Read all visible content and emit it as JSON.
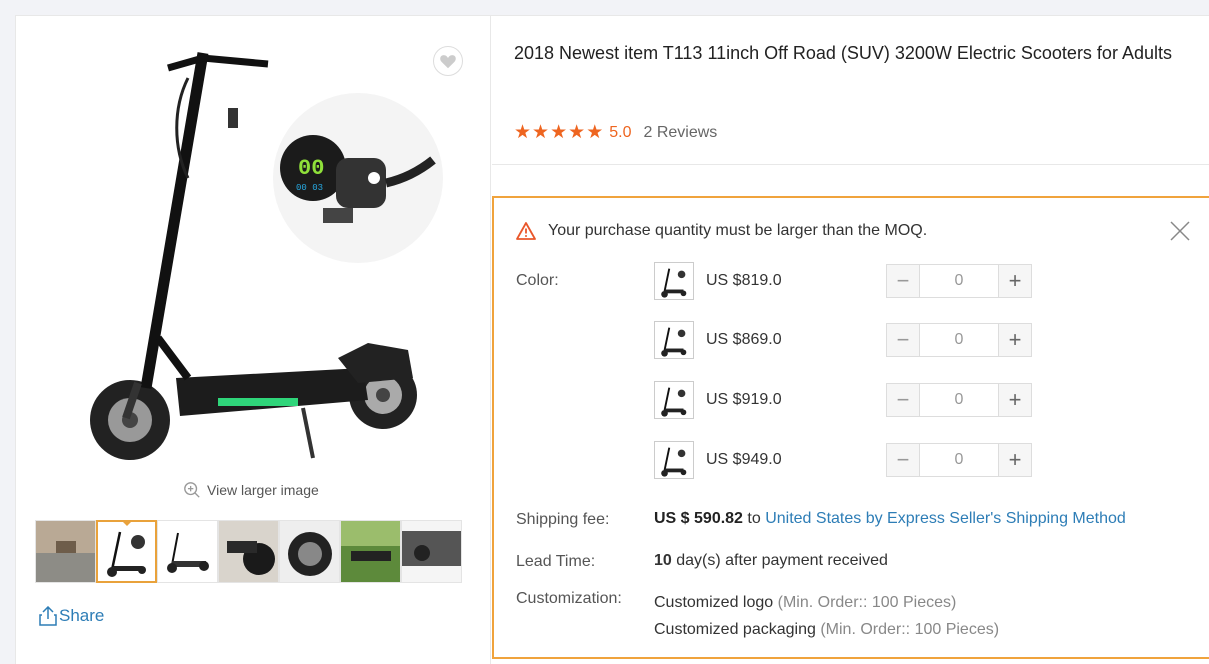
{
  "product": {
    "title": "2018 Newest item T113 11inch Off Road (SUV) 3200W Electric Scooters for Adults",
    "rating": "5.0",
    "reviews": "2 Reviews"
  },
  "gallery": {
    "view_larger": "View larger image",
    "share": "Share",
    "thumbnail_count": 7
  },
  "moq": {
    "alert": "Your purchase quantity must be larger than the MOQ.",
    "color_label": "Color:",
    "options": [
      {
        "price": "US $819.0",
        "qty": "0"
      },
      {
        "price": "US $869.0",
        "qty": "0"
      },
      {
        "price": "US $919.0",
        "qty": "0"
      },
      {
        "price": "US $949.0",
        "qty": "0"
      }
    ],
    "shipping_label": "Shipping fee:",
    "shipping_amount": "US $ 590.82",
    "shipping_to": "to",
    "shipping_link": "United States by Express Seller's Shipping Method",
    "lead_label": "Lead Time:",
    "lead_days": "10",
    "lead_text": "day(s) after payment received",
    "custom_label": "Customization:",
    "custom_logo": "Customized logo",
    "custom_logo_min": "(Min. Order:: 100 Pieces)",
    "custom_pack": "Customized packaging",
    "custom_pack_min": "(Min. Order:: 100 Pieces)"
  },
  "colors": {
    "accent_orange": "#ee6520",
    "border_orange": "#f0a33c",
    "link_blue": "#2d7db6"
  }
}
